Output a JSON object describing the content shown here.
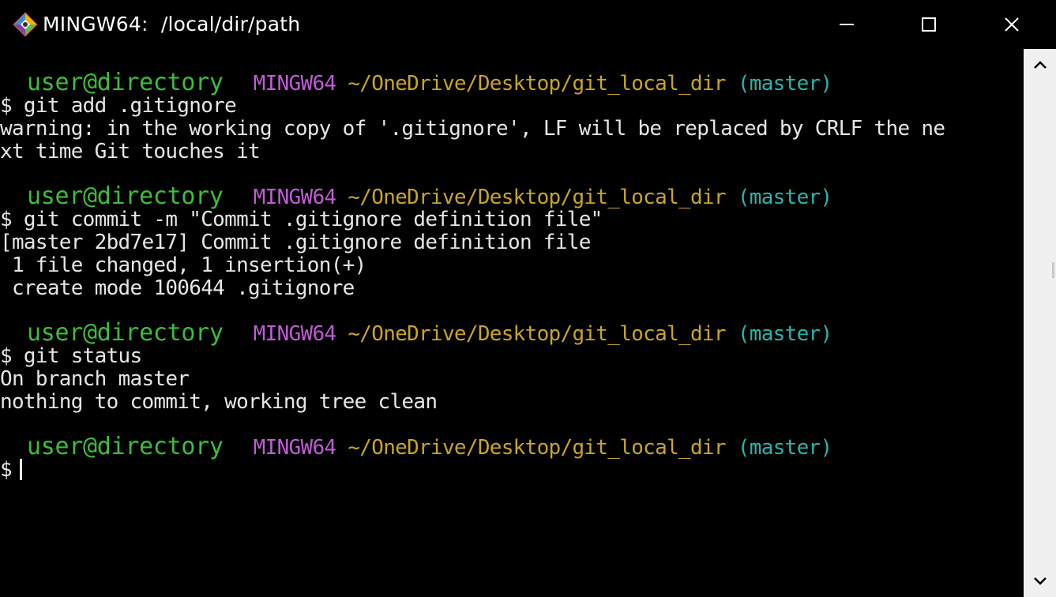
{
  "window": {
    "title": "MINGW64:  /local/dir/path",
    "icon": "git-bash-icon",
    "controls": [
      "minimize-icon",
      "maximize-icon",
      "close-icon"
    ]
  },
  "colors": {
    "background": "#000000",
    "text": "#e6e6e6",
    "user": "#3cbd3c",
    "system": "#c05bd6",
    "path": "#c9a524",
    "branch": "#2ab3ac"
  },
  "terminal": {
    "prompt": {
      "user": "user@directory",
      "system": "MINGW64",
      "path": "~/OneDrive/Desktop/git_local_dir",
      "branch": "(master)"
    },
    "block1": {
      "command": "$ git add .gitignore",
      "output": [
        "warning: in the working copy of '.gitignore', LF will be replaced by CRLF the ne",
        "xt time Git touches it"
      ]
    },
    "block2": {
      "command": "$ git commit -m \"Commit .gitignore definition file\"",
      "output": [
        "[master 2bd7e17] Commit .gitignore definition file",
        " 1 file changed, 1 insertion(+)",
        " create mode 100644 .gitignore"
      ]
    },
    "block3": {
      "command": "$ git status",
      "output": [
        "On branch master",
        "nothing to commit, working tree clean"
      ]
    },
    "block4": {
      "command": "$"
    }
  },
  "scrollbar": {
    "up_icon": "chevron-up-icon",
    "down_icon": "chevron-down-icon"
  }
}
